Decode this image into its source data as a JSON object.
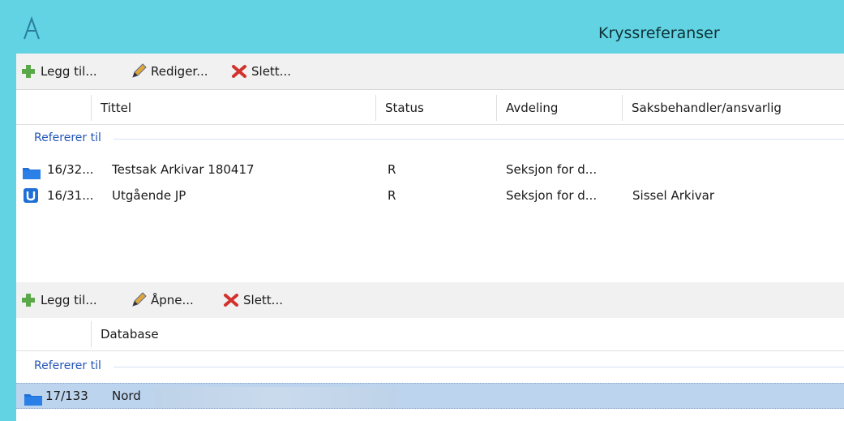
{
  "window": {
    "title": "Kryssreferanser",
    "logo_icon": "app-logo-icon",
    "accent_color": "#62d3e2"
  },
  "top_toolbar": {
    "add_label": "Legg til...",
    "edit_label": "Rediger...",
    "delete_label": "Slett..."
  },
  "top_table": {
    "columns": [
      "Tittel",
      "Status",
      "Avdeling",
      "Saksbehandler/ansvarlig"
    ],
    "group_label": "Refererer til",
    "rows": [
      {
        "icon": "folder-icon",
        "number": "16/32...",
        "title": "Testsak Arkivar 180417",
        "status": "R",
        "department": "Seksjon for d...",
        "handler": ""
      },
      {
        "icon": "outgoing-u-icon",
        "number": "16/31...",
        "title": "Utgående JP",
        "status": "R",
        "department": "Seksjon for d...",
        "handler": "Sissel Arkivar"
      }
    ]
  },
  "bottom_toolbar": {
    "add_label": "Legg til...",
    "open_label": "Åpne...",
    "delete_label": "Slett..."
  },
  "bottom_table": {
    "columns": [
      "Database"
    ],
    "group_label": "Refererer til",
    "rows": [
      {
        "icon": "folder-icon",
        "number": "17/133",
        "database": "Nord",
        "selected": true
      }
    ]
  }
}
